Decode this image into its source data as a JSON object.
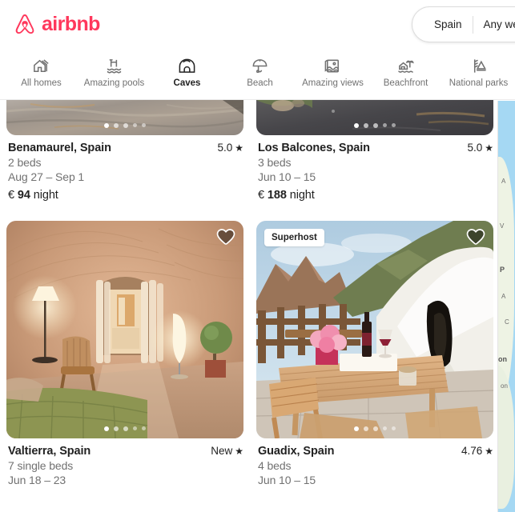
{
  "header": {
    "brand": "airbnb",
    "logo_color": "#FF385C",
    "logo_icon": "airbnb-bel-logo",
    "search": {
      "location": "Spain",
      "dates": "Any we",
      "dates_full": "Any week"
    }
  },
  "categories": [
    {
      "label": "All homes",
      "icon": "house-icon",
      "active": false
    },
    {
      "label": "Amazing pools",
      "icon": "pool-icon",
      "active": false
    },
    {
      "label": "Caves",
      "icon": "cave-icon",
      "active": true
    },
    {
      "label": "Beach",
      "icon": "beach-umbrella-icon",
      "active": false
    },
    {
      "label": "Amazing views",
      "icon": "landscape-view-icon",
      "active": false
    },
    {
      "label": "Beachfront",
      "icon": "beachfront-icon",
      "active": false
    },
    {
      "label": "National parks",
      "icon": "national-park-icon",
      "active": false
    }
  ],
  "listings": [
    {
      "title": "Benamaurel, Spain",
      "rating": "5.0",
      "beds": "2 beds",
      "dates": "Aug 27 – Sep 1",
      "price_currency": "€",
      "price_amount": "94",
      "price_unit": "night",
      "superhost": false,
      "photo_alt": "grey stone cave wall texture",
      "carousel_dots": 5,
      "carousel_active": 0,
      "clipped": true
    },
    {
      "title": "Los Balcones, Spain",
      "rating": "5.0",
      "beds": "3 beds",
      "dates": "Jun 10 – 15",
      "price_currency": "€",
      "price_amount": "188",
      "price_unit": "night",
      "superhost": false,
      "photo_alt": "dark slate rock with green vegetation",
      "carousel_dots": 5,
      "carousel_active": 0,
      "clipped": true
    },
    {
      "title": "Valtierra, Spain",
      "rating": "New",
      "beds": "7 single beds",
      "dates": "Jun 18 – 23",
      "price_currency": "",
      "price_amount": "",
      "price_unit": "",
      "superhost": false,
      "photo_alt": "warm lit cave interior with green quilted bed, lamps and topiary",
      "carousel_dots": 5,
      "carousel_active": 0,
      "clipped": false
    },
    {
      "title": "Guadix, Spain",
      "rating": "4.76",
      "beds": "4 beds",
      "dates": "Jun 10 – 15",
      "price_currency": "",
      "price_amount": "",
      "price_unit": "",
      "superhost": true,
      "superhost_label": "Superhost",
      "photo_alt": "terrace with wooden table, pink flowers, wine and whitewashed cave entrance",
      "carousel_dots": 5,
      "carousel_active": 0,
      "clipped": false
    }
  ],
  "map_panel": {
    "labels": [
      "A",
      "V",
      "P",
      "A",
      "C",
      "on",
      "on"
    ]
  },
  "icons": {
    "heart": "heart-icon",
    "star": "★"
  }
}
